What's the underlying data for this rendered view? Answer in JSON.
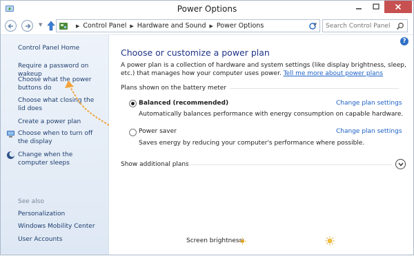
{
  "window": {
    "title": "Power Options",
    "minimize_icon": "minimize-icon",
    "maximize_icon": "maximize-icon",
    "close_icon": "close-icon"
  },
  "nav": {
    "back_icon": "back-arrow-icon",
    "forward_icon": "forward-arrow-icon",
    "breadcrumb": [
      "Control Panel",
      "Hardware and Sound",
      "Power Options"
    ],
    "search_placeholder": "Search Control Panel"
  },
  "sidebar": {
    "home": "Control Panel Home",
    "links": [
      "Require a password on wakeup",
      "Choose what the power buttons do",
      "Choose what closing the lid does",
      "Create a power plan",
      "Choose when to turn off the display",
      "Change when the computer sleeps"
    ],
    "see_also_label": "See also",
    "see_also": [
      "Personalization",
      "Windows Mobility Center",
      "User Accounts"
    ]
  },
  "main": {
    "help_label": "?",
    "heading": "Choose or customize a power plan",
    "description": "A power plan is a collection of hardware and system settings (like display brightness, sleep, etc.) that manages how your computer uses power.",
    "description_link": "Tell me more about power plans",
    "section_label": "Plans shown on the battery meter",
    "plans": [
      {
        "name": "Balanced (recommended)",
        "description": "Automatically balances performance with energy consumption on capable hardware.",
        "change_label": "Change plan settings",
        "selected": true
      },
      {
        "name": "Power saver",
        "description": "Saves energy by reducing your computer's performance where possible.",
        "change_label": "Change plan settings",
        "selected": false
      }
    ],
    "show_additional": "Show additional plans",
    "screen_brightness_label": "Screen brightness:"
  },
  "colors": {
    "accent_link": "#1a5fc7",
    "heading": "#1e3287",
    "close_button": "#c75050",
    "annotation_arrow": "#f2a43a"
  }
}
